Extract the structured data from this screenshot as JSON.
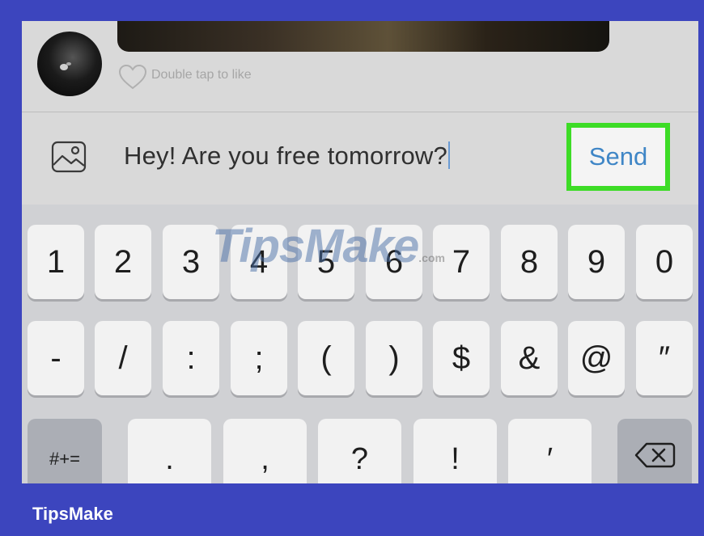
{
  "chat": {
    "like_hint": "Double tap to like"
  },
  "compose": {
    "message_text": "Hey! Are you free tomorrow?",
    "send_label": "Send"
  },
  "keyboard": {
    "row1": [
      "1",
      "2",
      "3",
      "4",
      "5",
      "6",
      "7",
      "8",
      "9",
      "0"
    ],
    "row2": [
      "-",
      "/",
      ":",
      ";",
      "(",
      ")",
      "$",
      "&",
      "@",
      "″"
    ],
    "row3": {
      "symbols_toggle": "#+=",
      "keys": [
        ".",
        ",",
        "?",
        "!",
        "′"
      ],
      "backspace_icon": "backspace-icon"
    }
  },
  "watermark": {
    "text": "TipsMake",
    "suffix": ".com"
  },
  "brand": {
    "name": "TipsMake"
  },
  "colors": {
    "frame": "#3c45be",
    "send_highlight": "#3ddc26",
    "send_text": "#3f86c6"
  }
}
